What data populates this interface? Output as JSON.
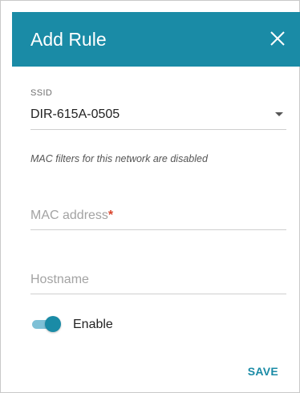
{
  "theme": {
    "accent": "#1a8ba6"
  },
  "dialog": {
    "title": "Add Rule",
    "close_icon": "close-icon"
  },
  "ssid": {
    "label": "SSID",
    "value": "DIR-615A-0505",
    "dropdown_icon": "chevron-down-icon"
  },
  "note": "MAC filters for this network are disabled",
  "mac": {
    "placeholder": "MAC address",
    "required_mark": "*"
  },
  "hostname": {
    "placeholder": "Hostname"
  },
  "enable": {
    "label": "Enable",
    "checked": true
  },
  "save_label": "SAVE"
}
